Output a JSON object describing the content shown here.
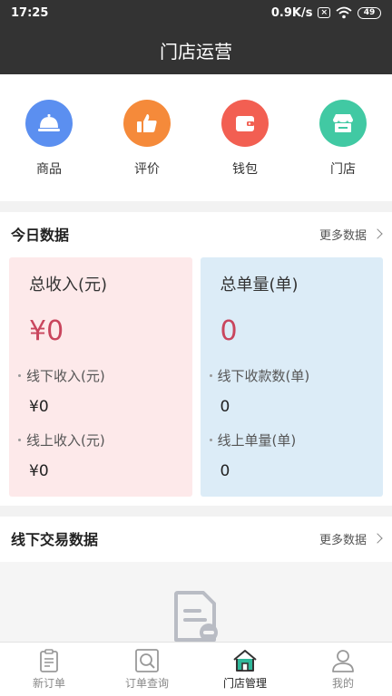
{
  "status_bar": {
    "time": "17:25",
    "net_speed": "0.9K/s",
    "sim_badge": "×",
    "battery": "49"
  },
  "header": {
    "title": "门店运营"
  },
  "quick_menu": [
    {
      "label": "商品",
      "icon": "service-bell-icon",
      "color": "#5b8ff0"
    },
    {
      "label": "评价",
      "icon": "thumbs-up-icon",
      "color": "#f58a3a"
    },
    {
      "label": "钱包",
      "icon": "wallet-icon",
      "color": "#f25f52"
    },
    {
      "label": "门店",
      "icon": "store-icon",
      "color": "#41c9a3"
    }
  ],
  "today": {
    "title": "今日数据",
    "more": "更多数据",
    "income": {
      "title": "总收入(元)",
      "total": "¥0",
      "offline_label": "线下收入(元)",
      "offline_value": "¥0",
      "online_label": "线上收入(元)",
      "online_value": "¥0"
    },
    "orders": {
      "title": "总单量(单)",
      "total": "0",
      "offline_label": "线下收款数(单)",
      "offline_value": "0",
      "online_label": "线上单量(单)",
      "online_value": "0"
    }
  },
  "offline": {
    "title": "线下交易数据",
    "more": "更多数据"
  },
  "tabs": [
    {
      "label": "新订单",
      "icon": "clipboard-icon",
      "active": false
    },
    {
      "label": "订单查询",
      "icon": "search-icon",
      "active": false
    },
    {
      "label": "门店管理",
      "icon": "home-icon",
      "active": true
    },
    {
      "label": "我的",
      "icon": "user-icon",
      "active": false
    }
  ],
  "colors": {
    "header_bg": "#333333",
    "accent_pink": "#c9455d",
    "card_pink": "#fde9ea",
    "card_blue": "#dcecf7",
    "tab_active": "#2fb89a"
  }
}
